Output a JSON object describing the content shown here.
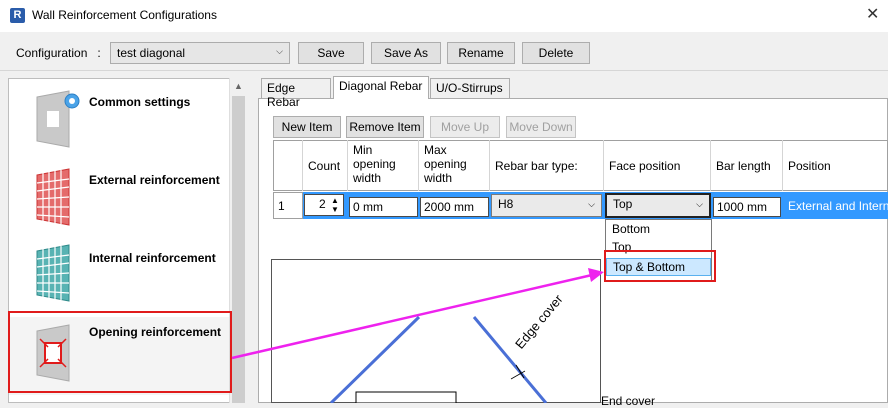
{
  "window": {
    "icon_letter": "R",
    "title": "Wall Reinforcement Configurations",
    "close_glyph": "✕"
  },
  "config": {
    "label": "Configuration",
    "colon": ":",
    "value": "test diagonal",
    "buttons": {
      "save": "Save",
      "save_as": "Save As",
      "rename": "Rename",
      "delete": "Delete"
    }
  },
  "nav": {
    "items": [
      {
        "label": "Common settings"
      },
      {
        "label": "External reinforcement"
      },
      {
        "label": "Internal reinforcement"
      },
      {
        "label": "Opening reinforcement"
      }
    ]
  },
  "tabs": [
    "Edge Rebar",
    "Diagonal Rebar",
    "U/O-Stirrups"
  ],
  "toolbar": {
    "new_item": "New Item",
    "remove_item": "Remove Item",
    "move_up": "Move Up",
    "move_down": "Move Down"
  },
  "grid": {
    "headers": [
      "Count",
      "Min opening width",
      "Max opening width",
      "Rebar bar type:",
      "Face position",
      "Bar length",
      "Position"
    ],
    "header_lines": {
      "min": [
        "Min",
        "opening",
        "width"
      ],
      "max": [
        "Max",
        "opening",
        "width"
      ]
    },
    "row": {
      "index": "1",
      "count": "2",
      "min_width": "0 mm",
      "max_width": "2000 mm",
      "bar_type": "H8",
      "face_position": "Top",
      "bar_length": "1000 mm",
      "position": "External and Interna"
    }
  },
  "dropdown": {
    "options": [
      "Bottom",
      "Top",
      "Top & Bottom"
    ],
    "highlighted": "Top & Bottom"
  },
  "diagram": {
    "edge_cover": "Edge cover",
    "end_cover": "End cover"
  },
  "colors": {
    "highlight_blue": "#3399ff",
    "annotation_red": "#e01b1b",
    "arrow_magenta": "#ee22ee",
    "rebar_blue": "#4a6fd6"
  }
}
